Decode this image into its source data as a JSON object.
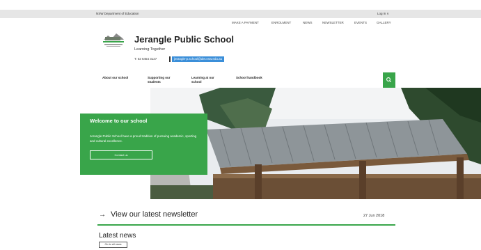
{
  "header": {
    "department": "NSW Department of Education",
    "login": "Log in  ∨"
  },
  "utility_nav": [
    {
      "label": "MAKE A PAYMENT"
    },
    {
      "label": "ENROLMENT"
    },
    {
      "label": "NEWS"
    },
    {
      "label": "NEWSLETTER"
    },
    {
      "label": "EVENTS"
    },
    {
      "label": "GALLERY"
    }
  ],
  "school": {
    "name": "Jerangle Public School",
    "tagline": "Learning Together",
    "phone": "T: 02 6454 3127",
    "email": "jerangle-p.school@det.nsw.edu.au"
  },
  "main_nav": [
    {
      "label": "About our school"
    },
    {
      "label": "Supporting our students"
    },
    {
      "label": "Learning at our school"
    },
    {
      "label": "School handbook"
    }
  ],
  "welcome": {
    "title": "Welcome to our school",
    "body": "Jerangle Public School have a proud tradition of pursuing academic, sporting and cultural excellence.",
    "button": "Contact us"
  },
  "newsletter": {
    "title": "View our latest newsletter",
    "date": "27 Jun 2018"
  },
  "news": {
    "title": "Latest news",
    "button": "Go to all news"
  },
  "colors": {
    "brand_green": "#39a54a",
    "email_highlight": "#3b8fd9",
    "top_bar": "#e6e6e6"
  },
  "icons": {
    "search": "search-icon",
    "arrow": "arrow-right-icon"
  }
}
